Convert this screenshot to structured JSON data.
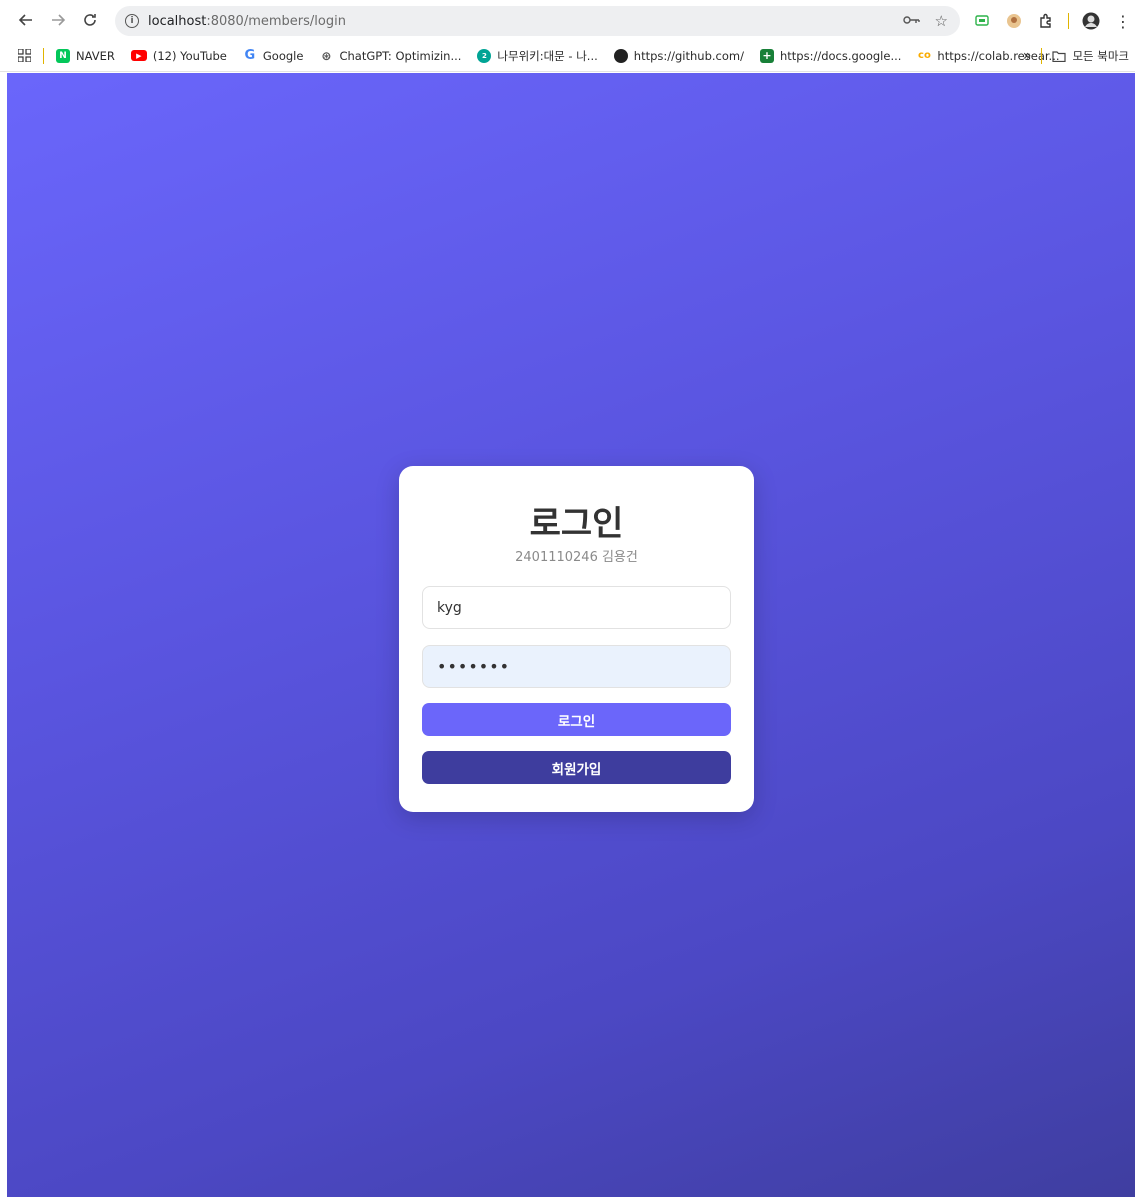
{
  "browser": {
    "url_host": "localhost",
    "url_path": ":8080/members/login"
  },
  "bookmarks": {
    "items": [
      {
        "label": "NAVER"
      },
      {
        "label": "(12) YouTube"
      },
      {
        "label": "Google"
      },
      {
        "label": "ChatGPT: Optimizin..."
      },
      {
        "label": "나무위키:대문 - 나..."
      },
      {
        "label": "https://github.com/"
      },
      {
        "label": "https://docs.google..."
      },
      {
        "label": "https://colab.resear..."
      }
    ],
    "overflow": "»",
    "all_bookmarks": "모든 북마크"
  },
  "login": {
    "title": "로그인",
    "subtitle": "2401110246 김용건",
    "username_value": "kyg",
    "password_value": "•••••••",
    "login_button": "로그인",
    "signup_button": "회원가입"
  },
  "colors": {
    "gradient_start": "#6a66fb",
    "gradient_end": "#3f3ea0",
    "login_button": "#6b66fa",
    "signup_button": "#3e3d9e"
  }
}
